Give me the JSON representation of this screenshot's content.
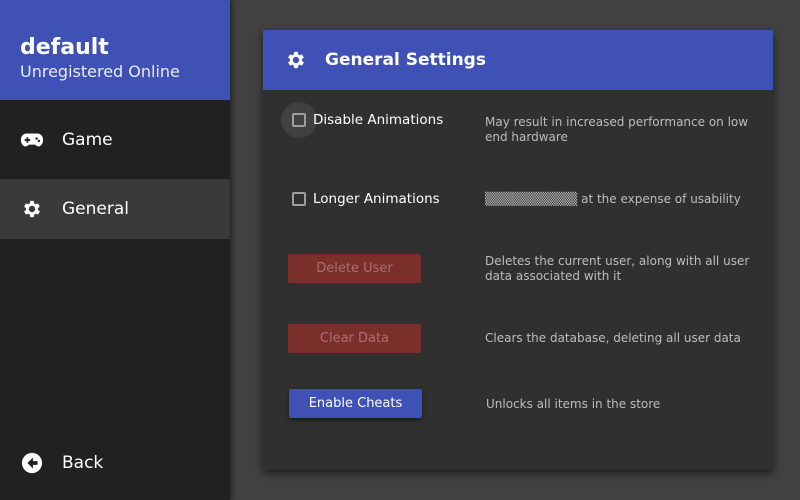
{
  "profile": {
    "name": "default",
    "status": "Unregistered Online"
  },
  "nav": {
    "game": {
      "label": "Game",
      "icon": "gamepad-icon"
    },
    "general": {
      "label": "General",
      "icon": "gear-icon"
    },
    "back": {
      "label": "Back",
      "icon": "back-arrow-icon"
    }
  },
  "panel": {
    "title": "General Settings",
    "icon": "gear-icon"
  },
  "settings": {
    "disable_animations": {
      "label": "Disable Animations",
      "checked": false,
      "description": "May result in increased performance on low end hardware"
    },
    "longer_animations": {
      "label": "Longer Animations",
      "checked": false,
      "description": "▒▒▒▒▒▒▒▒▒▒ at the expense of usability"
    },
    "delete_user": {
      "label": "Delete User",
      "description": "Deletes the current user, along with all user data associated with it"
    },
    "clear_data": {
      "label": "Clear Data",
      "description": "Clears the database, deleting all user data"
    },
    "enable_cheats": {
      "label": "Enable Cheats",
      "description": "Unlocks all items in the store"
    }
  },
  "colors": {
    "accent": "#3f51b5",
    "danger": "#7a2f2b",
    "sidebar": "#212121",
    "panel": "#303030",
    "background": "#424242"
  }
}
